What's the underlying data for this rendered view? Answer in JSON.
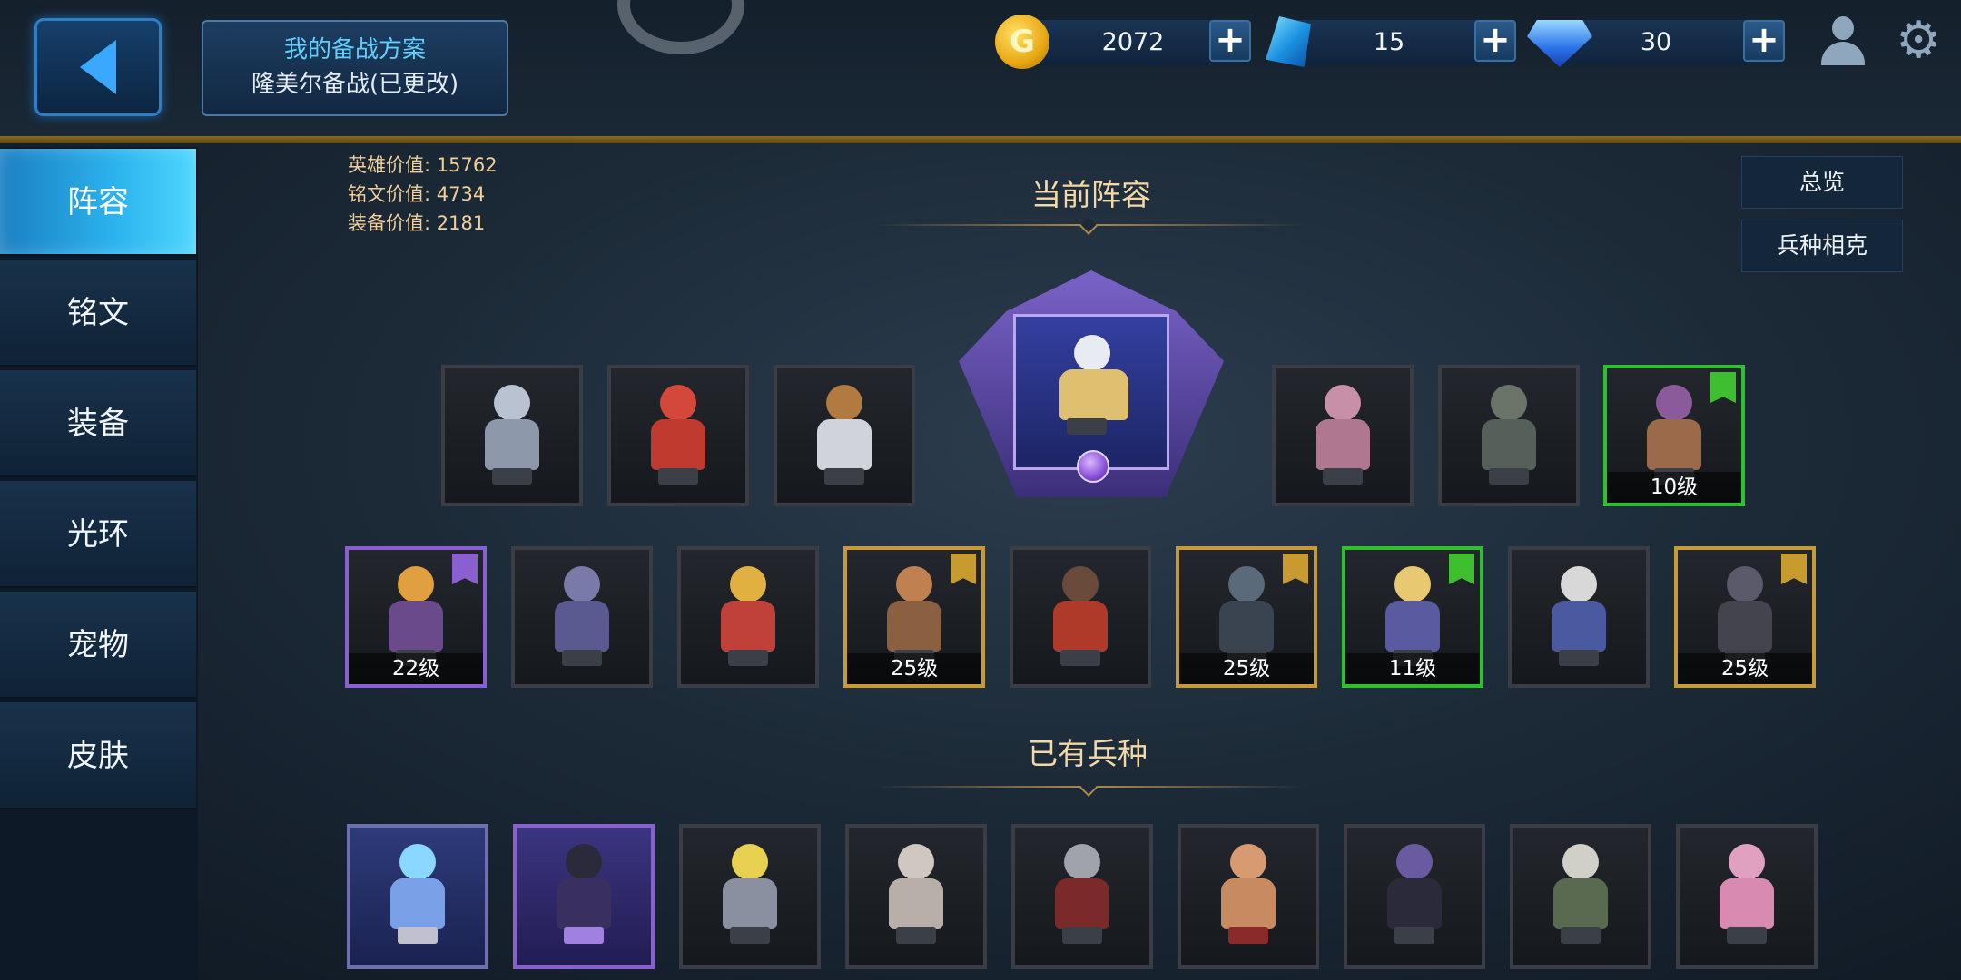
{
  "header": {
    "plan_title": "我的备战方案",
    "plan_name": "隆美尔备战(已更改)"
  },
  "currencies": {
    "gold": "2072",
    "crystal": "15",
    "diamond": "30",
    "gold_icon_letter": "G",
    "plus": "+"
  },
  "sidebar": {
    "items": [
      {
        "label": "阵容"
      },
      {
        "label": "铭文"
      },
      {
        "label": "装备"
      },
      {
        "label": "光环"
      },
      {
        "label": "宠物"
      },
      {
        "label": "皮肤"
      }
    ]
  },
  "stats": {
    "hero_value": "英雄价值: 15762",
    "rune_value": "铭文价值: 4734",
    "equip_value": "装备价值: 2181"
  },
  "buttons": {
    "overview": "总览",
    "counter": "兵种相克"
  },
  "sections": {
    "current_lineup": "当前阵容",
    "owned_units": "已有兵种"
  },
  "lineup_row1": [
    {
      "level": ""
    },
    {
      "level": ""
    },
    {
      "level": ""
    },
    {
      "level": ""
    },
    {
      "level": ""
    },
    {
      "level": "10级"
    }
  ],
  "lineup_row2": [
    {
      "level": "22级"
    },
    {
      "level": ""
    },
    {
      "level": ""
    },
    {
      "level": "25级"
    },
    {
      "level": ""
    },
    {
      "level": "25级"
    },
    {
      "level": "11级"
    },
    {
      "level": ""
    },
    {
      "level": "25级"
    }
  ],
  "colors": {
    "accent": "#2cb4ee",
    "gold_border": "#c69a36",
    "green_border": "#2fbf2f",
    "purple_border": "#8a5fd0",
    "stat_text": "#f0cf9a",
    "title_text": "#f3d9a8"
  },
  "icons": {
    "back": "back-arrow-icon",
    "settings": "gear-icon",
    "profile": "profile-icon",
    "gold": "gold-coin-icon",
    "crystal": "blue-crystal-icon",
    "diamond": "diamond-icon"
  }
}
